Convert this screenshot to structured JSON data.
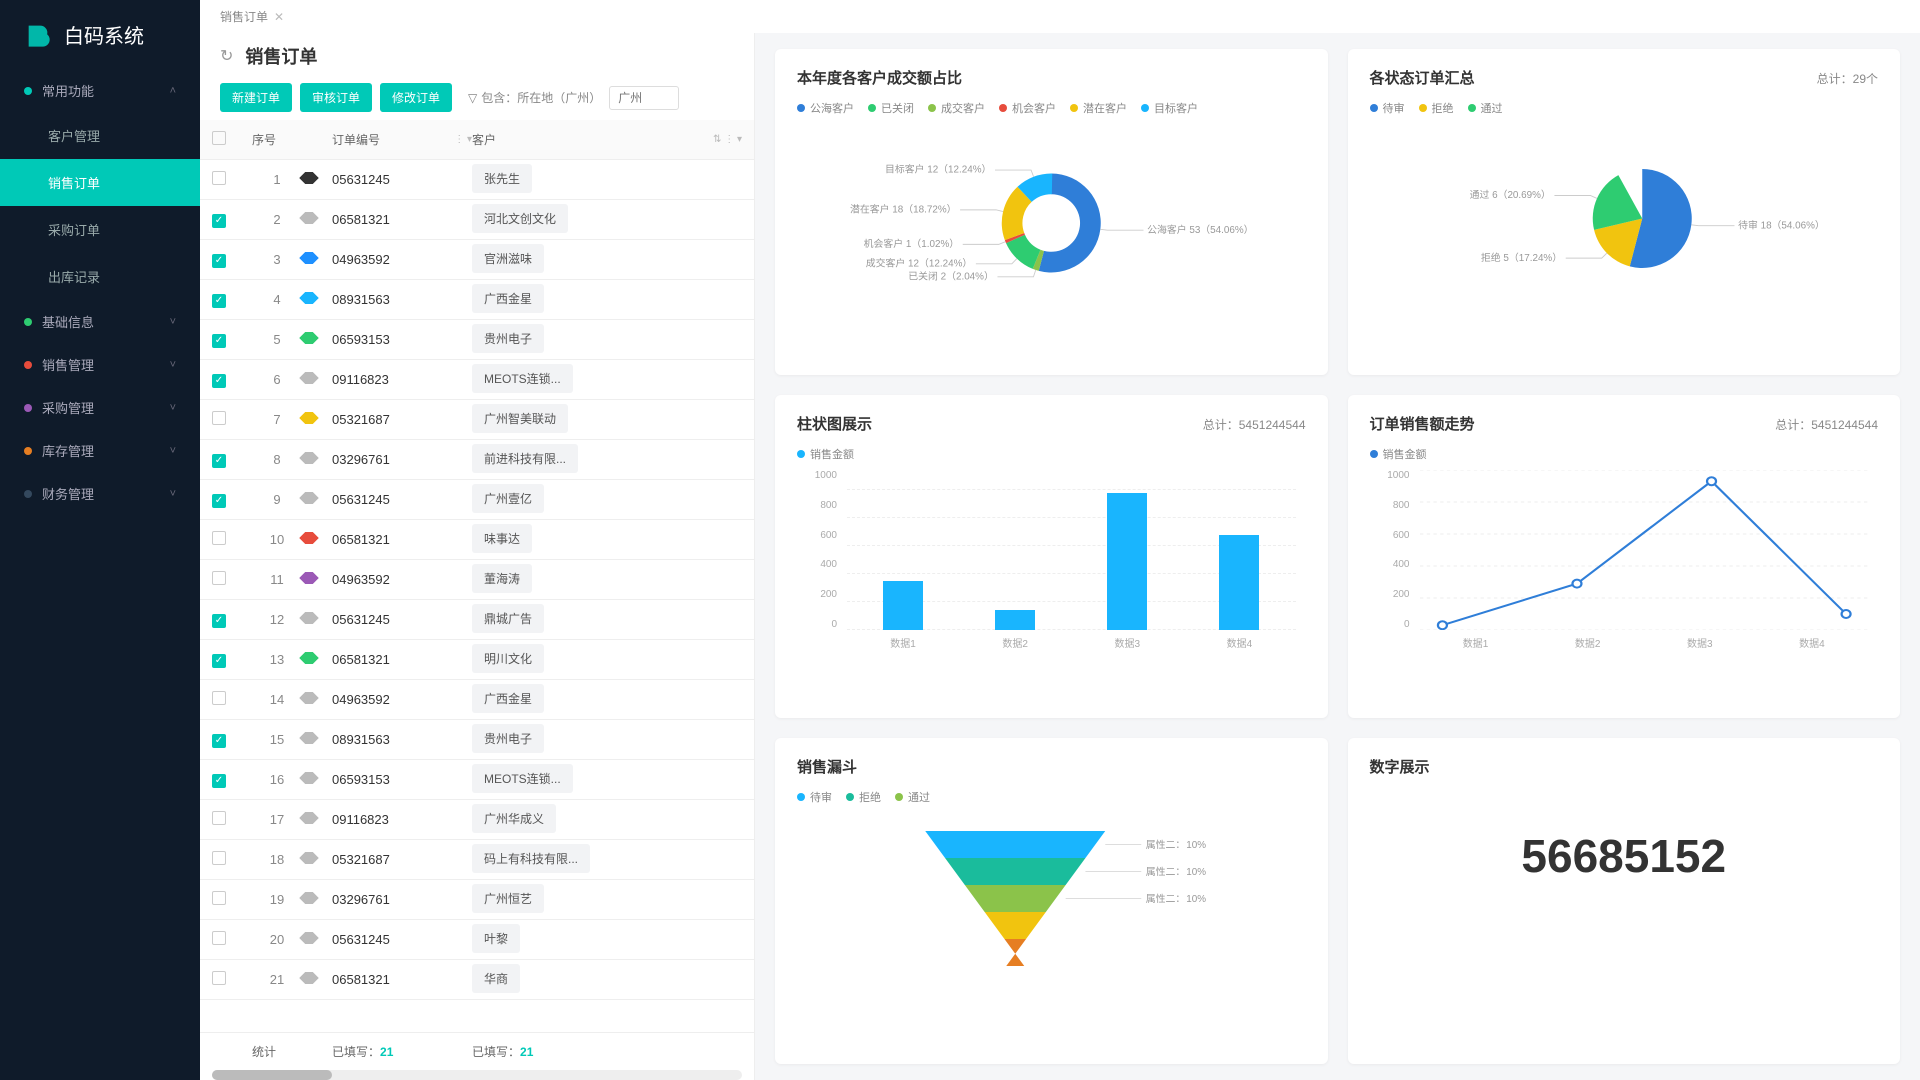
{
  "app": {
    "name": "白码系统"
  },
  "breadcrumb": [
    "销售订单"
  ],
  "nav": {
    "sections": [
      {
        "label": "常用功能",
        "color": "#00c9b7",
        "expanded": true,
        "items": [
          {
            "label": "客户管理"
          },
          {
            "label": "销售订单",
            "active": true
          },
          {
            "label": "采购订单"
          },
          {
            "label": "出库记录"
          }
        ]
      },
      {
        "label": "基础信息",
        "color": "#2ecc71"
      },
      {
        "label": "销售管理",
        "color": "#e74c3c"
      },
      {
        "label": "采购管理",
        "color": "#9b59b6"
      },
      {
        "label": "库存管理",
        "color": "#e67e22"
      },
      {
        "label": "财务管理",
        "color": "#34495e"
      }
    ]
  },
  "page": {
    "title": "销售订单",
    "buttons": {
      "new": "新建订单",
      "audit": "审核订单",
      "edit": "修改订单"
    },
    "filter": {
      "label": "包含：所在地（广州）"
    },
    "search": {
      "placeholder": "广州"
    }
  },
  "table": {
    "cols": {
      "seq": "序号",
      "orderNo": "订单编号",
      "customer": "客户"
    },
    "rows": [
      {
        "seq": 1,
        "chk": false,
        "tag": "#333",
        "no": "05631245",
        "cust": "张先生"
      },
      {
        "seq": 2,
        "chk": true,
        "tag": "#bbb",
        "no": "06581321",
        "cust": "河北文创文化"
      },
      {
        "seq": 3,
        "chk": true,
        "tag": "#1e90ff",
        "no": "04963592",
        "cust": "官洲滋味"
      },
      {
        "seq": 4,
        "chk": true,
        "tag": "#19b5fe",
        "no": "08931563",
        "cust": "广西金星"
      },
      {
        "seq": 5,
        "chk": true,
        "tag": "#2ecc71",
        "no": "06593153",
        "cust": "贵州电子"
      },
      {
        "seq": 6,
        "chk": true,
        "tag": "#bbb",
        "no": "09116823",
        "cust": "MEOTS连锁..."
      },
      {
        "seq": 7,
        "chk": false,
        "tag": "#f1c40f",
        "no": "05321687",
        "cust": "广州智美联动"
      },
      {
        "seq": 8,
        "chk": true,
        "tag": "#bbb",
        "no": "03296761",
        "cust": "前进科技有限..."
      },
      {
        "seq": 9,
        "chk": true,
        "tag": "#bbb",
        "no": "05631245",
        "cust": "广州壹亿"
      },
      {
        "seq": 10,
        "chk": false,
        "tag": "#e74c3c",
        "no": "06581321",
        "cust": "味事达"
      },
      {
        "seq": 11,
        "chk": false,
        "tag": "#9b59b6",
        "no": "04963592",
        "cust": "董海涛"
      },
      {
        "seq": 12,
        "chk": true,
        "tag": "#bbb",
        "no": "05631245",
        "cust": "鼎城广告"
      },
      {
        "seq": 13,
        "chk": true,
        "tag": "#2ecc71",
        "no": "06581321",
        "cust": "明川文化"
      },
      {
        "seq": 14,
        "chk": false,
        "tag": "#bbb",
        "no": "04963592",
        "cust": "广西金星"
      },
      {
        "seq": 15,
        "chk": true,
        "tag": "#bbb",
        "no": "08931563",
        "cust": "贵州电子"
      },
      {
        "seq": 16,
        "chk": true,
        "tag": "#bbb",
        "no": "06593153",
        "cust": "MEOTS连锁..."
      },
      {
        "seq": 17,
        "chk": false,
        "tag": "#bbb",
        "no": "09116823",
        "cust": "广州华成义"
      },
      {
        "seq": 18,
        "chk": false,
        "tag": "#bbb",
        "no": "05321687",
        "cust": "码上有科技有限..."
      },
      {
        "seq": 19,
        "chk": false,
        "tag": "#bbb",
        "no": "03296761",
        "cust": "广州恒艺"
      },
      {
        "seq": 20,
        "chk": false,
        "tag": "#bbb",
        "no": "05631245",
        "cust": "叶黎"
      },
      {
        "seq": 21,
        "chk": false,
        "tag": "#bbb",
        "no": "06581321",
        "cust": "华商"
      }
    ],
    "footer": {
      "label": "统计",
      "orderNo": "已填写：",
      "orderNoVal": "21",
      "cust": "已填写：",
      "custVal": "21"
    }
  },
  "charts": {
    "donut": {
      "title": "本年度各客户成交额占比",
      "legend": [
        {
          "name": "公海客户",
          "color": "#2f7ed8"
        },
        {
          "name": "已关闭",
          "color": "#2ecc71"
        },
        {
          "name": "成交客户",
          "color": "#8bc34a"
        },
        {
          "name": "机会客户",
          "color": "#e74c3c"
        },
        {
          "name": "潜在客户",
          "color": "#f1c40f"
        },
        {
          "name": "目标客户",
          "color": "#19b5fe"
        }
      ],
      "slices": [
        {
          "label": "公海客户 53（54.06%）",
          "value": 54.06,
          "color": "#2f7ed8"
        },
        {
          "label": "已关闭 2（2.04%）",
          "value": 2.04,
          "color": "#8bc34a"
        },
        {
          "label": "成交客户 12（12.24%）",
          "value": 12.24,
          "color": "#2ecc71"
        },
        {
          "label": "机会客户 1（1.02%）",
          "value": 1.02,
          "color": "#e74c3c"
        },
        {
          "label": "潜在客户 18（18.72%）",
          "value": 18.72,
          "color": "#f1c40f"
        },
        {
          "label": "目标客户 12（12.24%）",
          "value": 12.24,
          "color": "#19b5fe"
        }
      ]
    },
    "pie": {
      "title": "各状态订单汇总",
      "total": "总计：29个",
      "legend": [
        {
          "name": "待审",
          "color": "#2f7ed8"
        },
        {
          "name": "拒绝",
          "color": "#f1c40f"
        },
        {
          "name": "通过",
          "color": "#2ecc71"
        }
      ],
      "slices": [
        {
          "label": "待审 18（54.06%）",
          "value": 54.06,
          "color": "#2f7ed8"
        },
        {
          "label": "拒绝 5（17.24%）",
          "value": 17.24,
          "color": "#f1c40f"
        },
        {
          "label": "通过 6（20.69%）",
          "value": 20.69,
          "color": "#2ecc71"
        }
      ]
    },
    "bar": {
      "title": "柱状图展示",
      "total": "总计：5451244544",
      "series": "销售金额",
      "seriesColor": "#19b5fe",
      "ymax": 1000,
      "yticks": [
        0,
        200,
        400,
        600,
        800,
        1000
      ],
      "categories": [
        "数据1",
        "数据2",
        "数据3",
        "数据4"
      ],
      "values": [
        350,
        140,
        980,
        680
      ]
    },
    "line": {
      "title": "订单销售额走势",
      "total": "总计：5451244544",
      "series": "销售金额",
      "seriesColor": "#2f7ed8",
      "ymax": 1000,
      "yticks": [
        0,
        200,
        400,
        600,
        800,
        1000
      ],
      "categories": [
        "数据1",
        "数据2",
        "数据3",
        "数据4"
      ],
      "values": [
        30,
        290,
        930,
        100
      ]
    },
    "funnel": {
      "title": "销售漏斗",
      "legend": [
        {
          "name": "待审",
          "color": "#19b5fe"
        },
        {
          "name": "拒绝",
          "color": "#1abc9c"
        },
        {
          "name": "通过",
          "color": "#8bc34a"
        }
      ],
      "rows": [
        {
          "label": "属性二：",
          "value": "10%",
          "color": "#19b5fe"
        },
        {
          "label": "属性二：",
          "value": "10%",
          "color": "#1abc9c"
        },
        {
          "label": "属性二：",
          "value": "10%",
          "color": "#8bc34a"
        },
        {
          "label": "",
          "value": "",
          "color": "#f1c40f"
        },
        {
          "label": "",
          "value": "",
          "color": "#e67e22"
        }
      ]
    },
    "number": {
      "title": "数字展示",
      "value": "56685152"
    }
  },
  "chart_data": [
    {
      "type": "pie",
      "title": "本年度各客户成交额占比",
      "series": [
        {
          "name": "公海客户",
          "value": 53,
          "pct": 54.06
        },
        {
          "name": "已关闭",
          "value": 2,
          "pct": 2.04
        },
        {
          "name": "成交客户",
          "value": 12,
          "pct": 12.24
        },
        {
          "name": "机会客户",
          "value": 1,
          "pct": 1.02
        },
        {
          "name": "潜在客户",
          "value": 18,
          "pct": 18.72
        },
        {
          "name": "目标客户",
          "value": 12,
          "pct": 12.24
        }
      ]
    },
    {
      "type": "pie",
      "title": "各状态订单汇总",
      "total": 29,
      "series": [
        {
          "name": "待审",
          "value": 18,
          "pct": 54.06
        },
        {
          "name": "拒绝",
          "value": 5,
          "pct": 17.24
        },
        {
          "name": "通过",
          "value": 6,
          "pct": 20.69
        }
      ]
    },
    {
      "type": "bar",
      "title": "柱状图展示",
      "ylabel": "销售金额",
      "ylim": [
        0,
        1000
      ],
      "categories": [
        "数据1",
        "数据2",
        "数据3",
        "数据4"
      ],
      "values": [
        350,
        140,
        980,
        680
      ]
    },
    {
      "type": "line",
      "title": "订单销售额走势",
      "ylabel": "销售金额",
      "ylim": [
        0,
        1000
      ],
      "categories": [
        "数据1",
        "数据2",
        "数据3",
        "数据4"
      ],
      "values": [
        30,
        290,
        930,
        100
      ]
    },
    {
      "type": "funnel",
      "title": "销售漏斗",
      "series": [
        {
          "name": "待审",
          "label": "属性二",
          "pct": 10
        },
        {
          "name": "拒绝",
          "label": "属性二",
          "pct": 10
        },
        {
          "name": "通过",
          "label": "属性二",
          "pct": 10
        }
      ]
    },
    {
      "type": "number",
      "title": "数字展示",
      "value": 56685152
    }
  ]
}
